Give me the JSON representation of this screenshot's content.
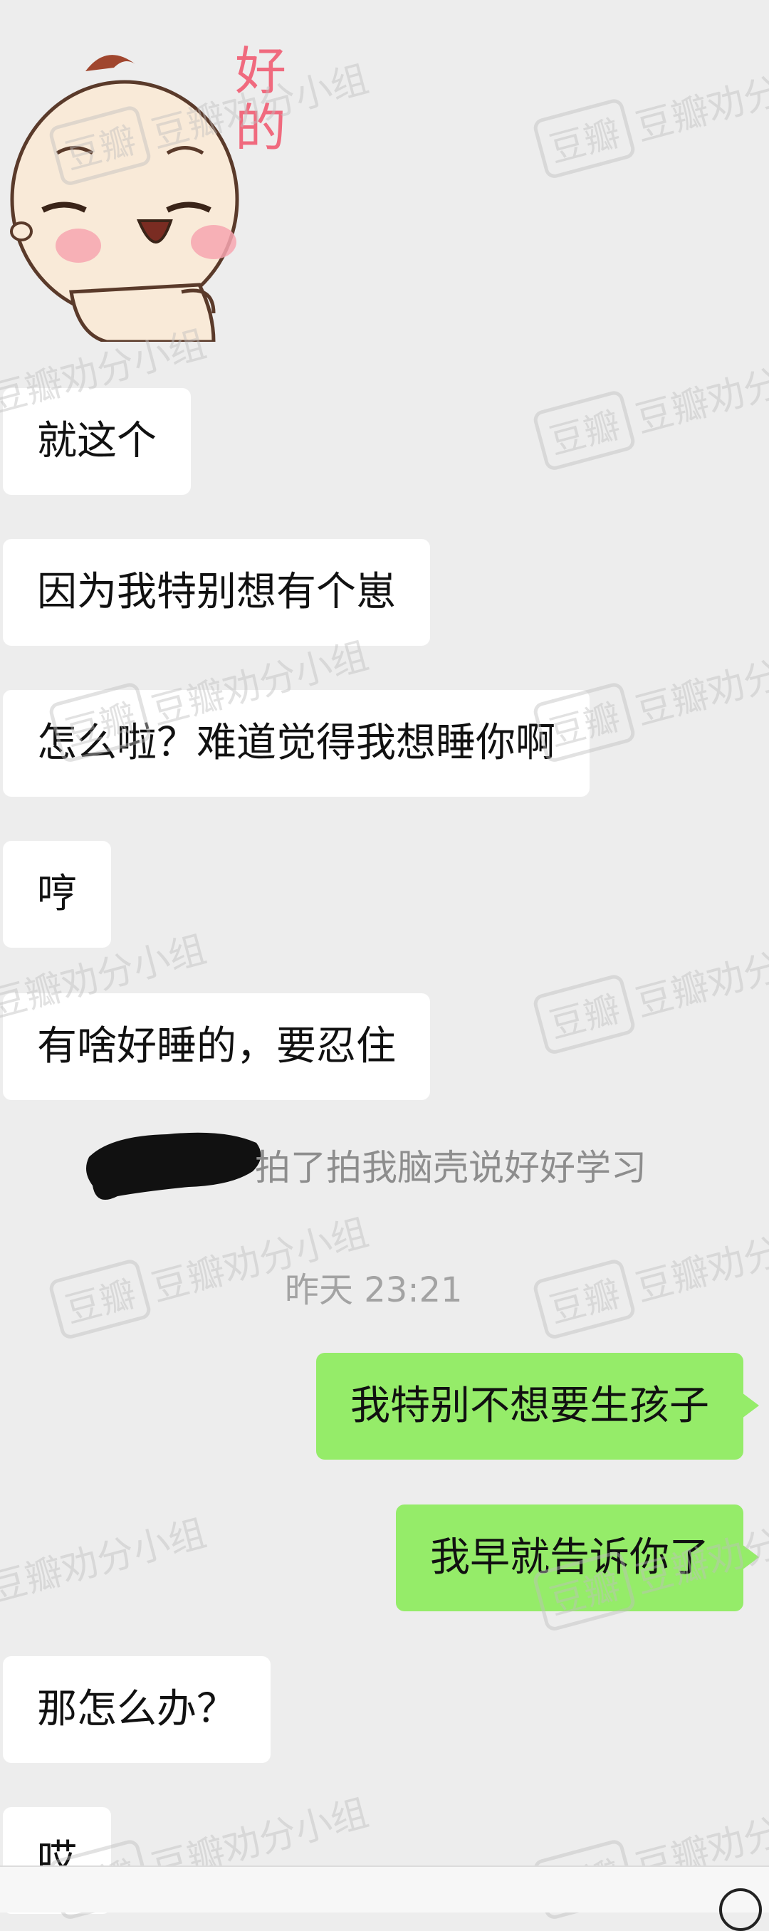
{
  "sticker": {
    "caption": "好的"
  },
  "messages": [
    {
      "side": "in",
      "text": "就这个"
    },
    {
      "side": "in",
      "text": "因为我特别想有个崽"
    },
    {
      "side": "in",
      "text": "怎么啦？难道觉得我想睡你啊"
    },
    {
      "side": "in",
      "text": "哼"
    },
    {
      "side": "in",
      "text": "有啥好睡的，要忍住"
    },
    {
      "side": "out",
      "text": "我特别不想要生孩子"
    },
    {
      "side": "out",
      "text": "我早就告诉你了"
    },
    {
      "side": "in",
      "text": "那怎么办？"
    },
    {
      "side": "in",
      "text": "哎"
    }
  ],
  "system": {
    "pat_text": "拍了拍我脑壳说好好学习",
    "timestamp": "昨天 23:21"
  },
  "watermark": {
    "box": "豆瓣",
    "text": "豆瓣劝分小组"
  },
  "colors": {
    "background": "#ededed",
    "incoming": "#ffffff",
    "outgoing": "#95ec69"
  }
}
